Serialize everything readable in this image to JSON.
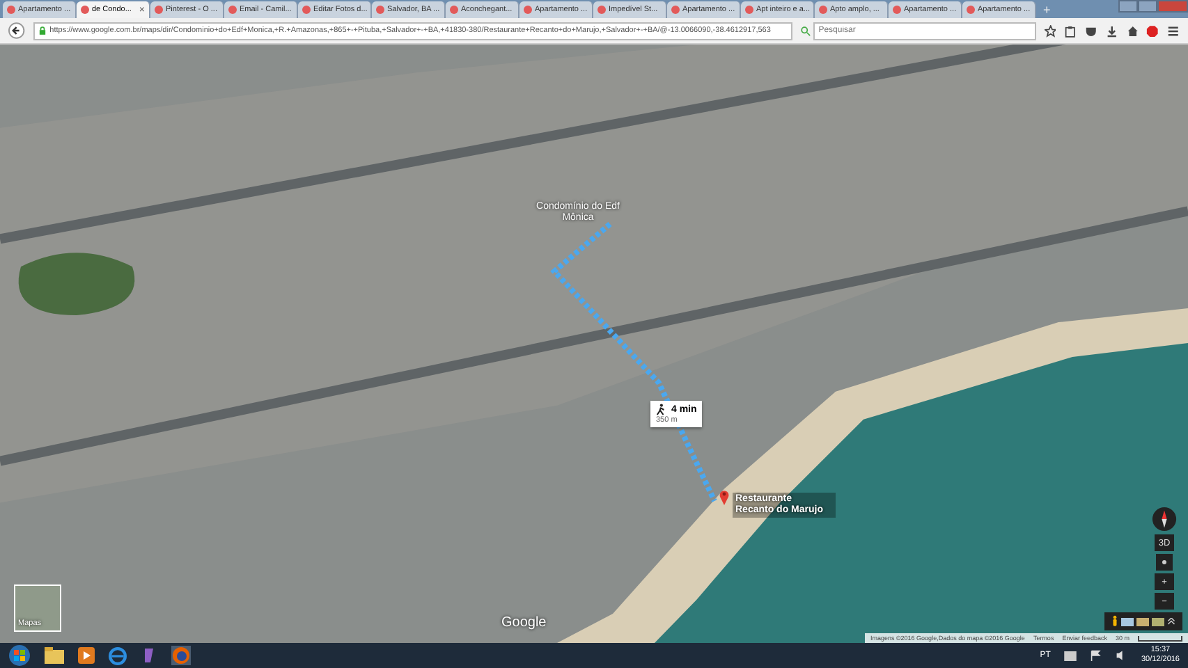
{
  "tabs": [
    {
      "label": "Apartamento ...",
      "selected": false
    },
    {
      "label": "de Condo...",
      "selected": true
    },
    {
      "label": "Pinterest - O ...",
      "selected": false
    },
    {
      "label": "Email - Camil...",
      "selected": false
    },
    {
      "label": "Editar Fotos d...",
      "selected": false
    },
    {
      "label": "Salvador, BA ...",
      "selected": false
    },
    {
      "label": "Aconchegant...",
      "selected": false
    },
    {
      "label": "Apartamento ...",
      "selected": false
    },
    {
      "label": "Impedível St...",
      "selected": false
    },
    {
      "label": "Apartamento ...",
      "selected": false
    },
    {
      "label": "Apt inteiro e a...",
      "selected": false
    },
    {
      "label": "Apto amplo, ...",
      "selected": false
    },
    {
      "label": "Apartamento ...",
      "selected": false
    },
    {
      "label": "Apartamento ...",
      "selected": false
    }
  ],
  "close_tab": "×",
  "new_tab": "+",
  "address_bar": {
    "url": "https://www.google.com.br/maps/dir/Condominio+do+Edf+Monica,+R.+Amazonas,+865+-+Pituba,+Salvador+-+BA,+41830-380/Restaurante+Recanto+do+Marujo,+Salvador+-+BA/@-13.0066090,-38.4612917,563"
  },
  "search": {
    "placeholder": "Pesquisar"
  },
  "map": {
    "origin_label": "Condomínio do Edf Mônica",
    "route": {
      "time": "4 min",
      "distance": "350 m"
    },
    "destination_label": "Restaurante Recanto do Marujo",
    "logo": "Google",
    "layer_thumbnail": "Mapas",
    "controls": {
      "tilt": "3D",
      "zoom_in": "+",
      "zoom_out": "−"
    },
    "attribution": [
      "Imagens ©2016 Google,Dados do mapa ©2016 Google",
      "Termos",
      "Enviar feedback"
    ],
    "scale": "30 m"
  },
  "taskbar": {
    "language": "PT",
    "time": "15:37",
    "date": "30/12/2016"
  }
}
